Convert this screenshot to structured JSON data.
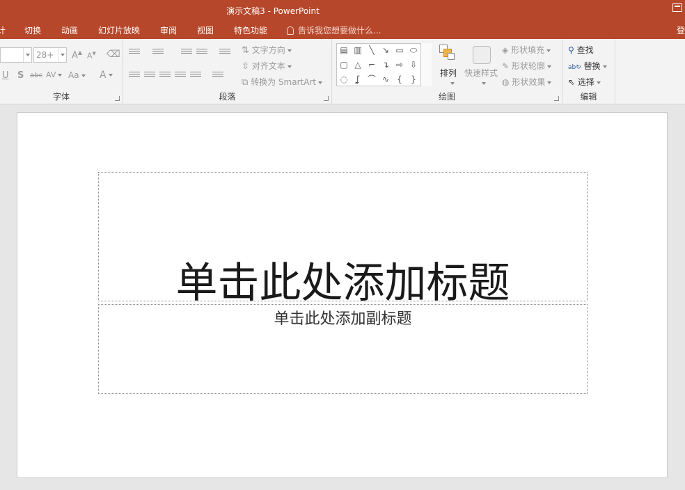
{
  "window": {
    "title": "演示文稿3 - PowerPoint"
  },
  "tabs": [
    {
      "label": "计"
    },
    {
      "label": "切换"
    },
    {
      "label": "动画"
    },
    {
      "label": "幻灯片放映"
    },
    {
      "label": "审阅"
    },
    {
      "label": "视图"
    },
    {
      "label": "特色功能"
    }
  ],
  "tell_me": {
    "text": "告诉我您想要做什么..."
  },
  "signin": {
    "text": "登"
  },
  "ribbon": {
    "font": {
      "label": "字体",
      "size_value": "28+",
      "grow_label": "A",
      "shrink_label": "A",
      "underline_label": "U",
      "shadow_label": "S",
      "strike_label": "abc",
      "spacing_label": "AV",
      "case_label": "Aa",
      "color_label": "A"
    },
    "paragraph": {
      "label": "段落",
      "text_direction": "文字方向",
      "align_text": "对齐文本",
      "convert_smartart": "转换为 SmartArt"
    },
    "drawing": {
      "label": "绘图",
      "arrange": "排列",
      "quick_styles": "快速样式",
      "shape_fill": "形状填充",
      "shape_outline": "形状轮廓",
      "shape_effects": "形状效果"
    },
    "editing": {
      "label": "编辑",
      "find": "查找",
      "replace": "替换",
      "select": "选择"
    }
  },
  "slide": {
    "title_placeholder": "单击此处添加标题",
    "subtitle_placeholder": "单击此处添加副标题"
  }
}
